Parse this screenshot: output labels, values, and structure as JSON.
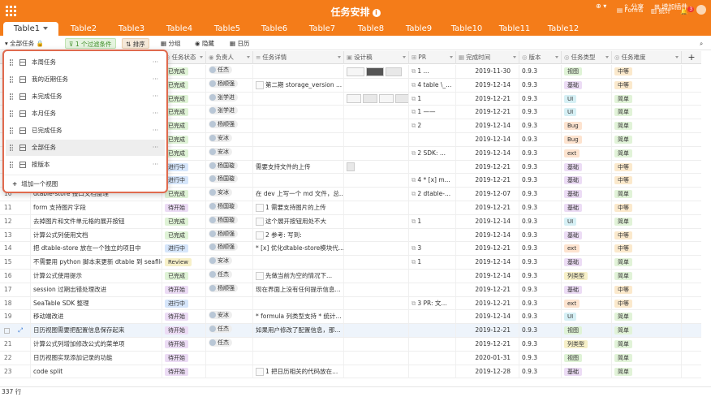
{
  "app": {
    "title": "任务安排",
    "forms": "Forms",
    "stats": "统计",
    "notif_count": "3",
    "share": "分享",
    "add_plugin": "增加插件"
  },
  "colors": {
    "brand": "#f47c19",
    "filter_green": "#3a8a22",
    "highlight": "#eef4fb",
    "dropdown_border": "#e06a4e"
  },
  "tabs": [
    "Table1",
    "Table2",
    "Table3",
    "Table4",
    "Table5",
    "Table6",
    "Table7",
    "Table8",
    "Table9",
    "Table10",
    "Table11",
    "Table12"
  ],
  "toolbar": {
    "view_name": "全部任务",
    "filter": "1 个过滤条件",
    "sort": "排序",
    "group": "分组",
    "hide": "隐藏",
    "calendar": "日历"
  },
  "columns": [
    "任务状态",
    "负责人",
    "任务详情",
    "设计稿",
    "PR",
    "完成时间",
    "版本",
    "任务类型",
    "任务难度"
  ],
  "views": {
    "items": [
      "本周任务",
      "我的近期任务",
      "未完成任务",
      "本月任务",
      "已完成任务",
      "全部任务",
      "按版本"
    ],
    "selected": "全部任务",
    "add": "增加一个视图"
  },
  "status_colors": {
    "已完成": "#dff3d6",
    "进行中": "#d6e6fb",
    "待开始": "#ecdcf5",
    "Review": "#f7f0c8"
  },
  "type_colors": {
    "视图": "#dff3d6",
    "基础": "#ecdcf5",
    "UI": "#d6f0f5",
    "Bug": "#fde3cf",
    "ext": "#fde3cf",
    "列类型": "#f7f0c8"
  },
  "diff_colors": {
    "中等": "#fbe9cc",
    "简单": "#e1f3d8"
  },
  "rows": [
    {
      "num": "",
      "title": "",
      "status": "已完成",
      "person": "任杰",
      "detail": "",
      "design": "imgs3",
      "pr": "1 ...",
      "date": "2019-11-30",
      "ver": "0.9.3",
      "type": "视图",
      "diff": "中等"
    },
    {
      "num": "",
      "title": "",
      "status": "已完成",
      "person": "杨顺强",
      "detail": "第二期 storage_version ...",
      "design": "",
      "pr": "4 table \\_...",
      "date": "2019-12-14",
      "ver": "0.9.3",
      "type": "基础",
      "diff": "中等"
    },
    {
      "num": "",
      "title": "",
      "status": "已完成",
      "person": "张学进",
      "detail": "",
      "design": "imgs4",
      "pr": "1",
      "date": "2019-12-21",
      "ver": "0.9.3",
      "type": "UI",
      "diff": "简单"
    },
    {
      "num": "",
      "title": "",
      "status": "已完成",
      "person": "张学进",
      "detail": "",
      "design": "",
      "pr": "1 ——",
      "date": "2019-12-21",
      "ver": "0.9.3",
      "type": "UI",
      "diff": "简单"
    },
    {
      "num": "",
      "title": "",
      "status": "已完成",
      "person": "杨顺强",
      "detail": "",
      "design": "",
      "pr": "2",
      "date": "2019-12-14",
      "ver": "0.9.3",
      "type": "Bug",
      "diff": "简单"
    },
    {
      "num": "",
      "title": "",
      "status": "已完成",
      "person": "安冰",
      "detail": "",
      "design": "",
      "pr": "",
      "date": "2019-12-14",
      "ver": "0.9.3",
      "type": "Bug",
      "diff": "简单"
    },
    {
      "num": "",
      "title": "",
      "status": "已完成",
      "person": "安冰",
      "detail": "",
      "design": "",
      "pr": "2 SDK: ...",
      "date": "2019-12-14",
      "ver": "0.9.3",
      "type": "ext",
      "diff": "简单"
    },
    {
      "num": "",
      "title": "",
      "status": "进行中",
      "person": "杨国璇",
      "detail": "需要支持文件的上传",
      "design": "doc",
      "pr": "",
      "date": "2019-12-21",
      "ver": "0.9.3",
      "type": "基础",
      "diff": "中等"
    },
    {
      "num": "",
      "title": "",
      "status": "进行中",
      "person": "杨国璇",
      "detail": "",
      "design": "",
      "pr": "4 * [x] m...",
      "date": "2019-12-21",
      "ver": "0.9.3",
      "type": "基础",
      "diff": "中等"
    },
    {
      "num": "10",
      "title": "dtable-store 接口文档整理",
      "status": "已完成",
      "person": "安冰",
      "detail": "在 dev 上写一个 md 文件，总...",
      "design": "",
      "pr": "2 dtable-...",
      "date": "2019-12-07",
      "ver": "0.9.3",
      "type": "基础",
      "diff": "简单"
    },
    {
      "num": "11",
      "title": "form 支持图片字段",
      "status": "待开始",
      "person": "杨国璇",
      "detail": "1 需要支持图片的上传",
      "design": "",
      "pr": "",
      "date": "2019-12-21",
      "ver": "0.9.3",
      "type": "基础",
      "diff": "中等"
    },
    {
      "num": "12",
      "title": "去掉图片和文件单元格的展开按钮",
      "status": "已完成",
      "person": "杨国璇",
      "detail": "这个展开按钮用处不大",
      "design": "",
      "pr": "1",
      "date": "2019-12-14",
      "ver": "0.9.3",
      "type": "UI",
      "diff": "简单"
    },
    {
      "num": "13",
      "title": "计算公式列使用文档",
      "status": "已完成",
      "person": "杨顺强",
      "detail": "2 参考: 写到:",
      "design": "",
      "pr": "",
      "date": "2019-12-14",
      "ver": "0.9.3",
      "type": "基础",
      "diff": "中等"
    },
    {
      "num": "14",
      "title": "把 dtable-store 放在一个独立的项目中",
      "status": "进行中",
      "person": "杨顺强",
      "detail": "* [x] 优化dtable-store模块代...",
      "design": "",
      "pr": "3",
      "date": "2019-12-21",
      "ver": "0.9.3",
      "type": "ext",
      "diff": "中等"
    },
    {
      "num": "15",
      "title": "不需要用 python 脚本来更新 dtable 到 seafile",
      "status": "Review",
      "person": "安冰",
      "detail": "",
      "design": "",
      "pr": "1",
      "date": "2019-12-14",
      "ver": "0.9.3",
      "type": "基础",
      "diff": "简单"
    },
    {
      "num": "16",
      "title": "计算公式使用提示",
      "status": "已完成",
      "person": "任杰",
      "detail": "先做当前为空的情况下...",
      "design": "",
      "pr": "",
      "date": "2019-12-14",
      "ver": "0.9.3",
      "type": "列类型",
      "diff": "简单"
    },
    {
      "num": "17",
      "title": "session 过期出错处理改进",
      "status": "待开始",
      "person": "杨顺强",
      "detail": "现在界面上没有任何提示信息...",
      "design": "",
      "pr": "",
      "date": "2019-12-21",
      "ver": "0.9.3",
      "type": "基础",
      "diff": "中等"
    },
    {
      "num": "18",
      "title": "SeaTable SDK 整理",
      "status": "进行中",
      "person": "",
      "detail": "",
      "design": "",
      "pr": "3 PR: 文...",
      "date": "2019-12-21",
      "ver": "0.9.3",
      "type": "ext",
      "diff": "中等"
    },
    {
      "num": "19",
      "title": "移动端改进",
      "status": "待开始",
      "person": "安冰",
      "detail": "* formula 列类型支持 * 统计...",
      "design": "",
      "pr": "",
      "date": "2019-12-14",
      "ver": "0.9.3",
      "type": "UI",
      "diff": "简单"
    },
    {
      "num": "",
      "title": "日历视图需要把配置信息保存起来",
      "status": "待开始",
      "person": "任杰",
      "detail": "如果用户修改了配置信息，那...",
      "design": "",
      "pr": "",
      "date": "2019-12-21",
      "ver": "0.9.3",
      "type": "视图",
      "diff": "简单"
    },
    {
      "num": "21",
      "title": "计算公式列增加修改公式的菜单项",
      "status": "待开始",
      "person": "任杰",
      "detail": "",
      "design": "",
      "pr": "",
      "date": "2019-12-21",
      "ver": "0.9.3",
      "type": "列类型",
      "diff": "简单"
    },
    {
      "num": "22",
      "title": "日历视图实现添加记录的功能",
      "status": "待开始",
      "person": "",
      "detail": "",
      "design": "",
      "pr": "",
      "date": "2020-01-31",
      "ver": "0.9.3",
      "type": "视图",
      "diff": "简单"
    },
    {
      "num": "23",
      "title": "code split",
      "status": "待开始",
      "person": "",
      "detail": "1 把日历相关的代码放在...",
      "design": "",
      "pr": "",
      "date": "2019-12-28",
      "ver": "0.9.3",
      "type": "基础",
      "diff": "简单"
    }
  ],
  "footer": {
    "count": "337 行"
  }
}
